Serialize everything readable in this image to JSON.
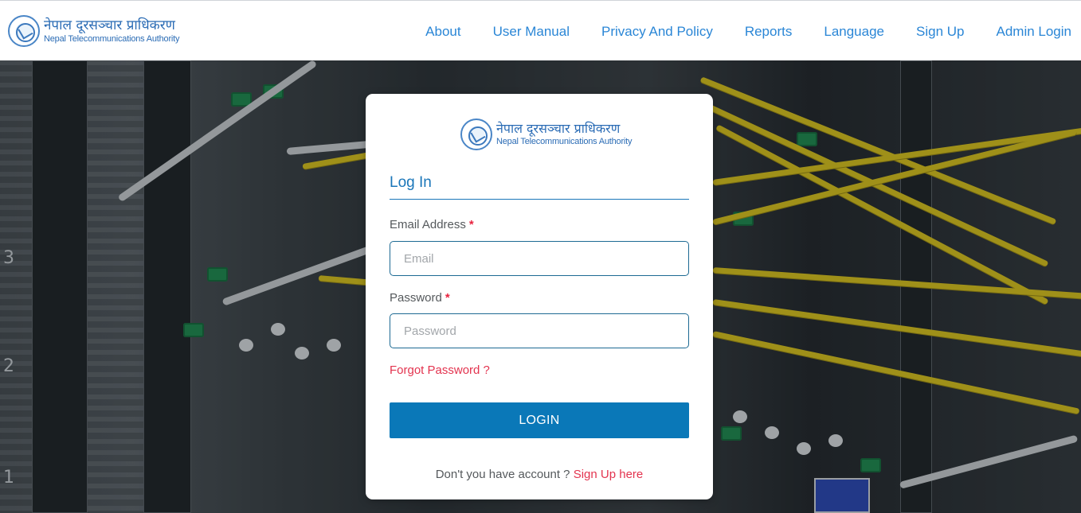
{
  "header": {
    "brand_nepali": "नेपाल दूरसञ्चार प्राधिकरण",
    "brand_english": "Nepal Telecommunications Authority",
    "nav": [
      {
        "label": "About"
      },
      {
        "label": "User Manual"
      },
      {
        "label": "Privacy And Policy"
      },
      {
        "label": "Reports"
      },
      {
        "label": "Language"
      },
      {
        "label": "Sign Up"
      },
      {
        "label": "Admin Login"
      }
    ]
  },
  "card": {
    "brand_nepali": "नेपाल दूरसञ्चार प्राधिकरण",
    "brand_english": "Nepal Telecommunications Authority",
    "title": "Log In",
    "email": {
      "label": "Email Address",
      "required_mark": "*",
      "placeholder": "Email",
      "value": ""
    },
    "password": {
      "label": "Password",
      "required_mark": "*",
      "placeholder": "Password",
      "value": ""
    },
    "forgot_label": "Forgot Password ?",
    "login_label": "LOGIN",
    "signup_prompt": "Don't you have account ?",
    "signup_link": "Sign Up here"
  },
  "background": {
    "rack_labels": [
      "3",
      "2",
      "1"
    ]
  },
  "colors": {
    "nav_link": "#2a86d6",
    "brand": "#2b6cb5",
    "title": "#1a76b9",
    "button": "#0a78b8",
    "accent_red": "#e3344f"
  }
}
